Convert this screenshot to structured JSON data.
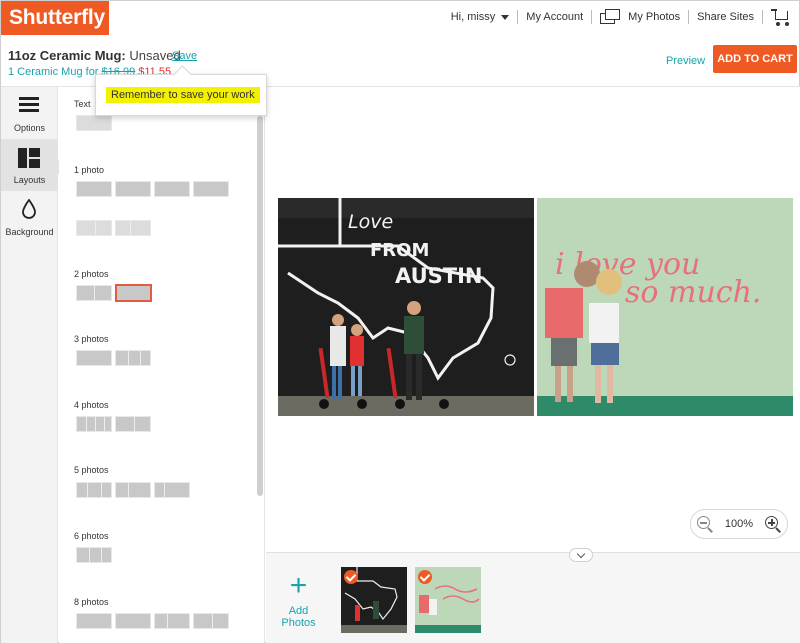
{
  "brand": {
    "logo": "Shutterfly"
  },
  "topnav": {
    "greeting": "Hi, missy",
    "my_account": "My Account",
    "my_photos": "My Photos",
    "share_sites": "Share Sites"
  },
  "product": {
    "title": "11oz Ceramic Mug:",
    "status": "Unsaved",
    "save_label": "Save",
    "quantity_label": "1 Ceramic Mug for",
    "old_price": "$16.99",
    "new_price": "$11.55"
  },
  "actions": {
    "preview": "Preview",
    "add_to_cart": "ADD TO CART"
  },
  "tooltip": {
    "text": "Remember to save your work"
  },
  "rail": [
    {
      "label": "Options"
    },
    {
      "label": "Layouts"
    },
    {
      "label": "Background"
    }
  ],
  "layouts": {
    "sections": [
      "Text",
      "1 photo",
      "2 photos",
      "3 photos",
      "4 photos",
      "5 photos",
      "6 photos",
      "8 photos"
    ]
  },
  "canvas": {
    "photo1_text": [
      "Love",
      "FROM",
      "AUSTIN"
    ],
    "photo2_text": [
      "i love you",
      "so much."
    ]
  },
  "zoom": {
    "level": "100%"
  },
  "tray": {
    "add_photos_line1": "Add",
    "add_photos_line2": "Photos"
  },
  "colors": {
    "brand_orange": "#ef5a24",
    "link_teal": "#1aa3ad",
    "price_red": "#e03030",
    "highlight_yellow": "#f3f000"
  }
}
